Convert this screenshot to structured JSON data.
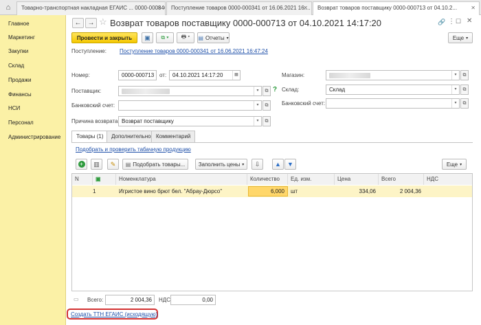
{
  "window_tabs": [
    {
      "label": "Товарно-транспортная накладная ЕГАИС ... 0000-000346",
      "active": false
    },
    {
      "label": "Поступление товаров 0000-000341 от 16.06.2021 16:...",
      "active": false
    },
    {
      "label": "Возврат товаров поставщику 0000-000713 от 04.10.2...",
      "active": true
    }
  ],
  "sidebar": {
    "items": [
      {
        "label": "Главное"
      },
      {
        "label": "Маркетинг"
      },
      {
        "label": "Закупки"
      },
      {
        "label": "Склад"
      },
      {
        "label": "Продажи"
      },
      {
        "label": "Финансы"
      },
      {
        "label": "НСИ"
      },
      {
        "label": "Персонал"
      },
      {
        "label": "Администрирование"
      }
    ]
  },
  "document": {
    "title": "Возврат товаров поставщику 0000-000713 от 04.10.2021 14:17:20",
    "post_close_label": "Провести и закрыть",
    "reports_label": "Отчеты",
    "more_label": "Еще",
    "basis_label": "Поступление:",
    "basis_link": "Поступление товаров 0000-000341 от 16.06.2021 16:47:24"
  },
  "form": {
    "number_label": "Номер:",
    "number_value": "0000-000713",
    "date_label": "от:",
    "date_value": "04.10.2021 14:17:20",
    "supplier_label": "Поставщик:",
    "bank_label": "Банковский счет:",
    "reason_label": "Причина возврата:",
    "reason_value": "Возврат поставщику",
    "store_label": "Магазин:",
    "warehouse_label": "Склад:",
    "warehouse_value": "Склад",
    "bank2_label": "Банковский счет:"
  },
  "form_tabs": [
    {
      "label": "Товары (1)",
      "active": true
    },
    {
      "label": "Дополнительно",
      "active": false
    },
    {
      "label": "Комментарий",
      "active": false
    }
  ],
  "goods": {
    "check_link": "Подобрать и проверить табачную продукцию",
    "pick_label": "Подобрать товары...",
    "fill_prices_label": "Заполнить цены",
    "more_label": "Еще",
    "columns": [
      "N",
      "",
      "Номенклатура",
      "Количество",
      "Ед. изм.",
      "Цена",
      "Всего",
      "НДС"
    ],
    "rows": [
      {
        "n": "1",
        "item": "Игристое вино брют бел. \"Абрау-Дюрсо\"",
        "qty": "6,000",
        "unit": "шт",
        "price": "334,06",
        "total": "2 004,36",
        "vat": ""
      }
    ]
  },
  "totals": {
    "total_label": "Всего:",
    "total_value": "2 004,36",
    "vat_label": "НДС:",
    "vat_value": "0,00"
  },
  "create_link": "Создать ТТН ЕГАИС (исходящую)"
}
